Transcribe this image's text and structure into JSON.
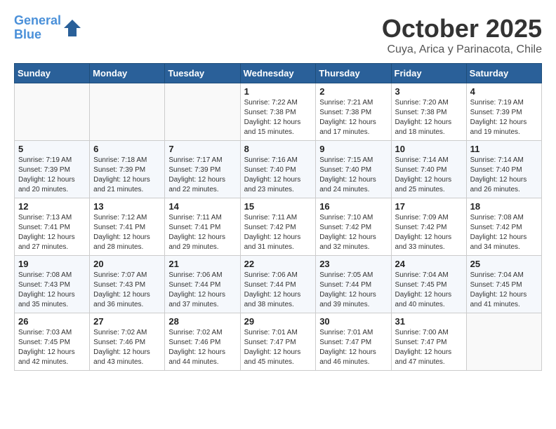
{
  "header": {
    "logo_line1": "General",
    "logo_line2": "Blue",
    "month": "October 2025",
    "location": "Cuya, Arica y Parinacota, Chile"
  },
  "days_of_week": [
    "Sunday",
    "Monday",
    "Tuesday",
    "Wednesday",
    "Thursday",
    "Friday",
    "Saturday"
  ],
  "weeks": [
    [
      {
        "day": "",
        "info": ""
      },
      {
        "day": "",
        "info": ""
      },
      {
        "day": "",
        "info": ""
      },
      {
        "day": "1",
        "info": "Sunrise: 7:22 AM\nSunset: 7:38 PM\nDaylight: 12 hours and 15 minutes."
      },
      {
        "day": "2",
        "info": "Sunrise: 7:21 AM\nSunset: 7:38 PM\nDaylight: 12 hours and 17 minutes."
      },
      {
        "day": "3",
        "info": "Sunrise: 7:20 AM\nSunset: 7:38 PM\nDaylight: 12 hours and 18 minutes."
      },
      {
        "day": "4",
        "info": "Sunrise: 7:19 AM\nSunset: 7:39 PM\nDaylight: 12 hours and 19 minutes."
      }
    ],
    [
      {
        "day": "5",
        "info": "Sunrise: 7:19 AM\nSunset: 7:39 PM\nDaylight: 12 hours and 20 minutes."
      },
      {
        "day": "6",
        "info": "Sunrise: 7:18 AM\nSunset: 7:39 PM\nDaylight: 12 hours and 21 minutes."
      },
      {
        "day": "7",
        "info": "Sunrise: 7:17 AM\nSunset: 7:39 PM\nDaylight: 12 hours and 22 minutes."
      },
      {
        "day": "8",
        "info": "Sunrise: 7:16 AM\nSunset: 7:40 PM\nDaylight: 12 hours and 23 minutes."
      },
      {
        "day": "9",
        "info": "Sunrise: 7:15 AM\nSunset: 7:40 PM\nDaylight: 12 hours and 24 minutes."
      },
      {
        "day": "10",
        "info": "Sunrise: 7:14 AM\nSunset: 7:40 PM\nDaylight: 12 hours and 25 minutes."
      },
      {
        "day": "11",
        "info": "Sunrise: 7:14 AM\nSunset: 7:40 PM\nDaylight: 12 hours and 26 minutes."
      }
    ],
    [
      {
        "day": "12",
        "info": "Sunrise: 7:13 AM\nSunset: 7:41 PM\nDaylight: 12 hours and 27 minutes."
      },
      {
        "day": "13",
        "info": "Sunrise: 7:12 AM\nSunset: 7:41 PM\nDaylight: 12 hours and 28 minutes."
      },
      {
        "day": "14",
        "info": "Sunrise: 7:11 AM\nSunset: 7:41 PM\nDaylight: 12 hours and 29 minutes."
      },
      {
        "day": "15",
        "info": "Sunrise: 7:11 AM\nSunset: 7:42 PM\nDaylight: 12 hours and 31 minutes."
      },
      {
        "day": "16",
        "info": "Sunrise: 7:10 AM\nSunset: 7:42 PM\nDaylight: 12 hours and 32 minutes."
      },
      {
        "day": "17",
        "info": "Sunrise: 7:09 AM\nSunset: 7:42 PM\nDaylight: 12 hours and 33 minutes."
      },
      {
        "day": "18",
        "info": "Sunrise: 7:08 AM\nSunset: 7:42 PM\nDaylight: 12 hours and 34 minutes."
      }
    ],
    [
      {
        "day": "19",
        "info": "Sunrise: 7:08 AM\nSunset: 7:43 PM\nDaylight: 12 hours and 35 minutes."
      },
      {
        "day": "20",
        "info": "Sunrise: 7:07 AM\nSunset: 7:43 PM\nDaylight: 12 hours and 36 minutes."
      },
      {
        "day": "21",
        "info": "Sunrise: 7:06 AM\nSunset: 7:44 PM\nDaylight: 12 hours and 37 minutes."
      },
      {
        "day": "22",
        "info": "Sunrise: 7:06 AM\nSunset: 7:44 PM\nDaylight: 12 hours and 38 minutes."
      },
      {
        "day": "23",
        "info": "Sunrise: 7:05 AM\nSunset: 7:44 PM\nDaylight: 12 hours and 39 minutes."
      },
      {
        "day": "24",
        "info": "Sunrise: 7:04 AM\nSunset: 7:45 PM\nDaylight: 12 hours and 40 minutes."
      },
      {
        "day": "25",
        "info": "Sunrise: 7:04 AM\nSunset: 7:45 PM\nDaylight: 12 hours and 41 minutes."
      }
    ],
    [
      {
        "day": "26",
        "info": "Sunrise: 7:03 AM\nSunset: 7:45 PM\nDaylight: 12 hours and 42 minutes."
      },
      {
        "day": "27",
        "info": "Sunrise: 7:02 AM\nSunset: 7:46 PM\nDaylight: 12 hours and 43 minutes."
      },
      {
        "day": "28",
        "info": "Sunrise: 7:02 AM\nSunset: 7:46 PM\nDaylight: 12 hours and 44 minutes."
      },
      {
        "day": "29",
        "info": "Sunrise: 7:01 AM\nSunset: 7:47 PM\nDaylight: 12 hours and 45 minutes."
      },
      {
        "day": "30",
        "info": "Sunrise: 7:01 AM\nSunset: 7:47 PM\nDaylight: 12 hours and 46 minutes."
      },
      {
        "day": "31",
        "info": "Sunrise: 7:00 AM\nSunset: 7:47 PM\nDaylight: 12 hours and 47 minutes."
      },
      {
        "day": "",
        "info": ""
      }
    ]
  ]
}
